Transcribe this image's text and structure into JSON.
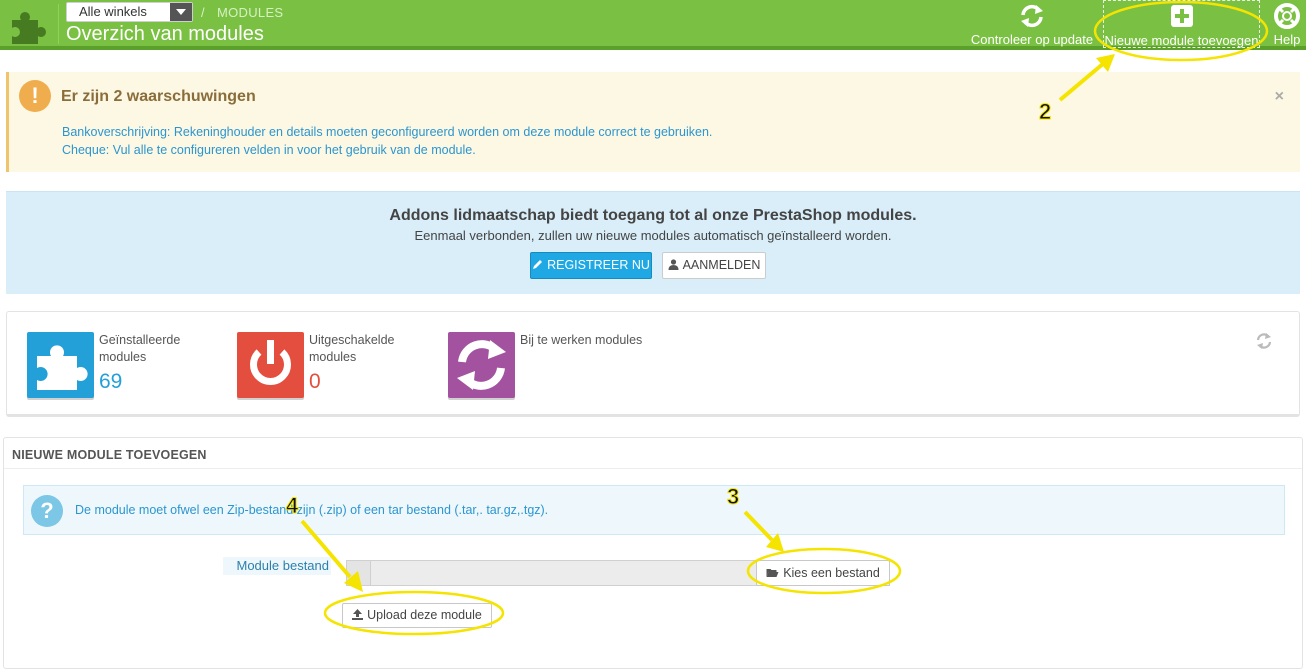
{
  "header": {
    "shop_selector": "Alle winkels",
    "breadcrumb": "MODULES",
    "title": "Overzich van modules",
    "buttons": {
      "update": "Controleer op update",
      "new_module": "Nieuwe module toevoegen",
      "help": "Help"
    },
    "accent_color": "#7ac143"
  },
  "warnings": {
    "title": "Er zijn 2 waarschuwingen",
    "lines": [
      "Bankoverschrijving: Rekeninghouder en details moeten geconfigureerd worden om deze module correct te gebruiken.",
      "Cheque: Vul alle te configureren velden in voor het gebruik van de module."
    ],
    "close": "×"
  },
  "addons": {
    "title": "Addons lidmaatschap biedt toegang tot al onze PrestaShop modules.",
    "subtitle": "Eenmaal verbonden, zullen uw nieuwe modules automatisch geïnstalleerd worden.",
    "register": "REGISTREER NU",
    "login": "AANMELDEN"
  },
  "stats": {
    "installed": {
      "label": "Geïnstalleerde modules",
      "value": "69",
      "color": "#24a0d8",
      "icon": "puzzle-icon"
    },
    "disabled": {
      "label": "Uitgeschakelde modules",
      "value": "0",
      "color": "#e44e3e",
      "icon": "power-icon"
    },
    "to_update": {
      "label": "Bij te werken modules",
      "color": "#a2529e",
      "icon": "refresh-icon"
    }
  },
  "new_module_panel": {
    "title": "NIEUWE MODULE TOEVOEGEN",
    "info": "De module moet ofwel een Zip-bestand zijn (.zip) of een tar bestand (.tar,. tar.gz,.tgz).",
    "field_label": "Module bestand",
    "choose_button": "Kies een bestand",
    "upload_button": "Upload deze module"
  },
  "callouts": {
    "c2": "2",
    "c3": "3",
    "c4": "4"
  }
}
